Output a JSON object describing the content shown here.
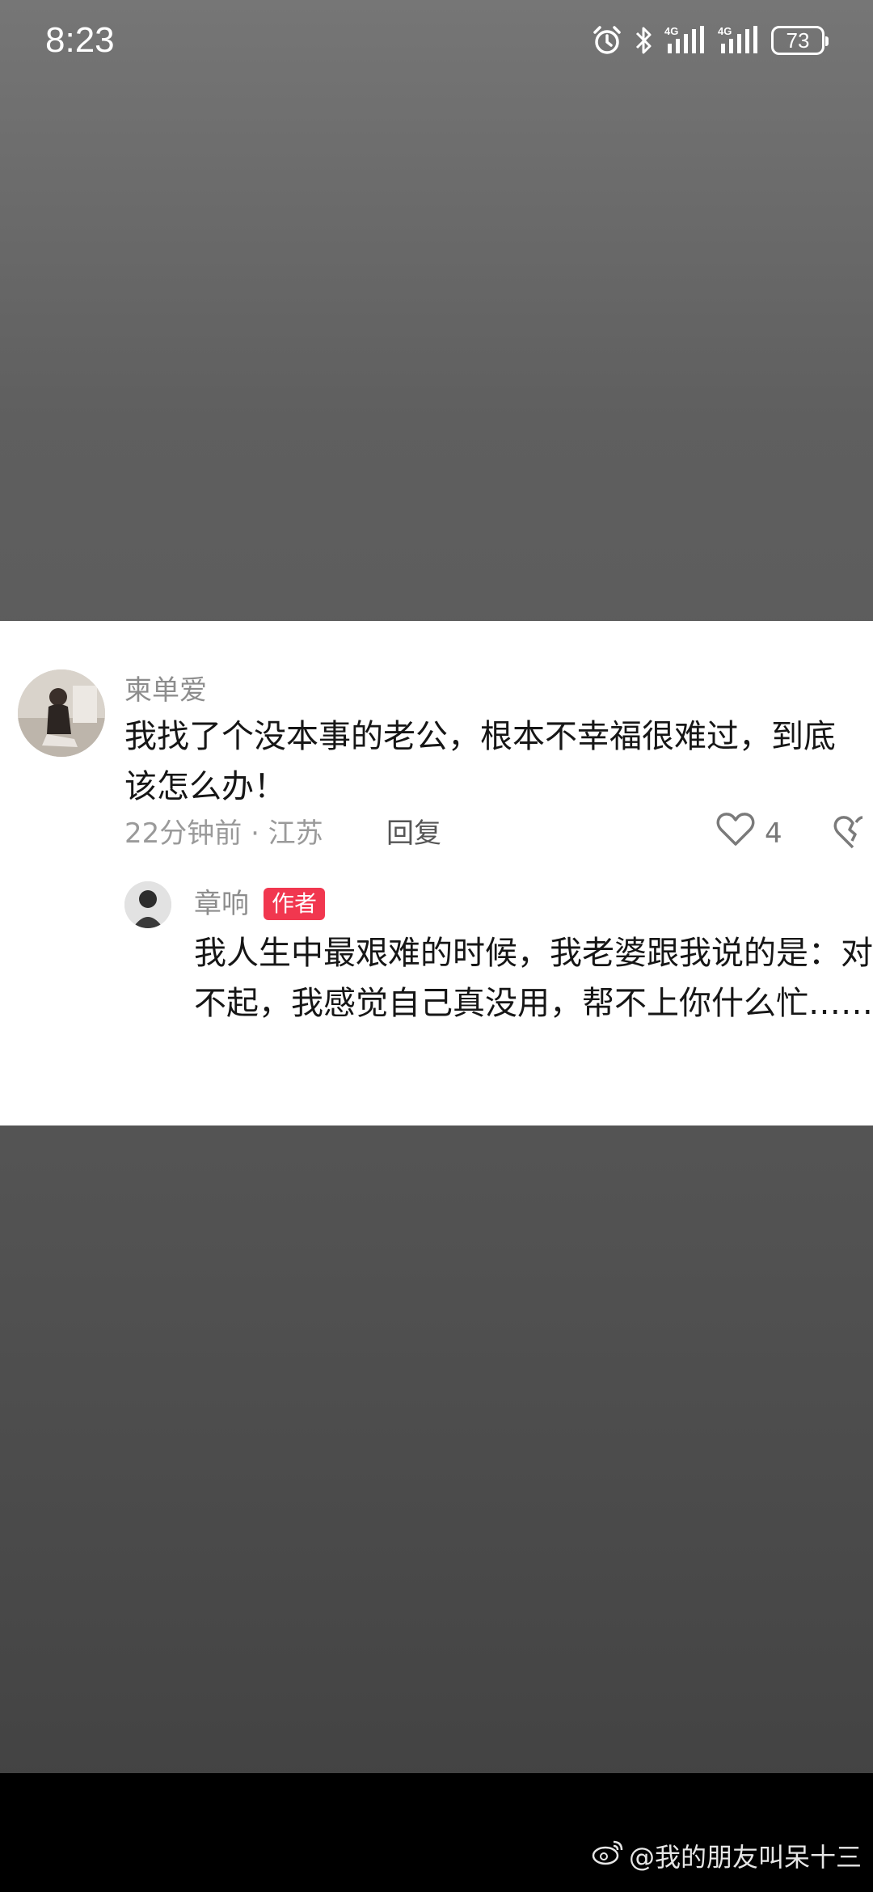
{
  "status_bar": {
    "time": "8:23",
    "icons": [
      "alarm-icon",
      "bluetooth-icon",
      "4g-signal-icon",
      "4g-signal-icon"
    ],
    "network_label_1": "4G",
    "network_label_2": "4G",
    "battery": "73"
  },
  "comment": {
    "username": "柬单爱",
    "text": "我找了个没本事的老公，根本不幸福很难过，到底该怎么办！",
    "meta": "22分钟前 · 江苏",
    "reply_label": "回复",
    "like_count": "4"
  },
  "reply": {
    "username": "章响",
    "badge": "作者",
    "text": "我人生中最艰难的时候，我老婆跟我说的是：对不起，我感觉自己真没用，帮不上你什么忙……"
  },
  "watermark": {
    "text": "@我的朋友叫呆十三",
    "icon": "weibo-icon"
  },
  "colors": {
    "background_top": "#767676",
    "background_bottom": "#404040",
    "card": "#ffffff",
    "badge": "#f1374f"
  }
}
